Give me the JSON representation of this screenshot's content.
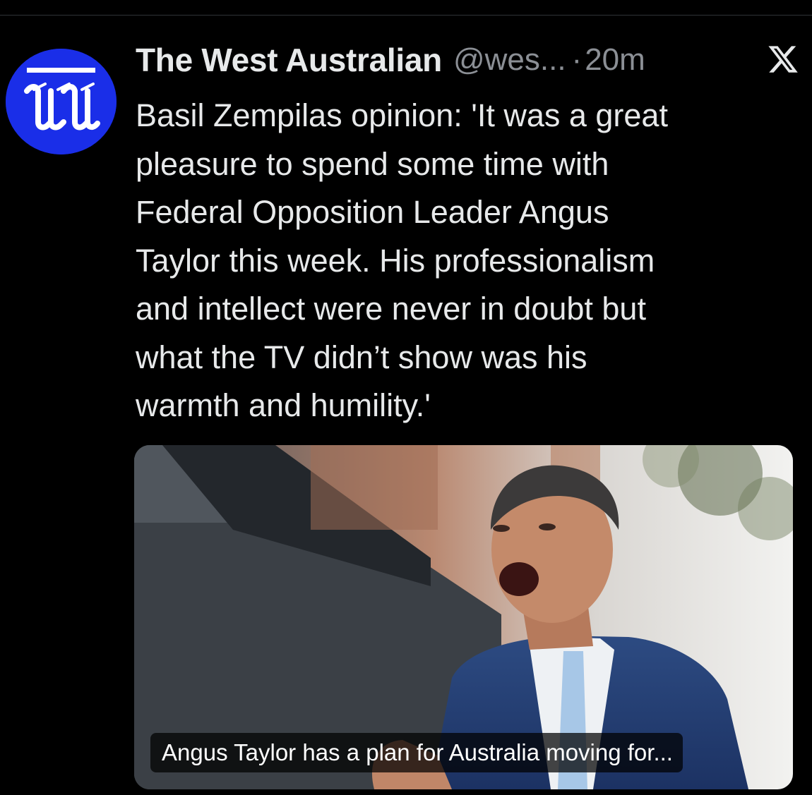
{
  "tweet": {
    "author_name": "The West Australian",
    "handle": "@wes...",
    "separator": "·",
    "timestamp": "20m",
    "text": "Basil Zempilas opinion: 'It was a great\npleasure to spend some time with\nFederal Opposition Leader Angus\nTaylor this week. His professionalism\nand intellect were never in doubt but\nwhat the TV didn’t show was his\nwarmth and humility.'",
    "platform_icon": "x-logo-icon",
    "avatar_logo_text": "W"
  },
  "media": {
    "caption": "Angus Taylor has a plan for Australia moving for..."
  },
  "colors": {
    "background": "#000000",
    "text_primary": "#e7e9ea",
    "text_secondary": "#8b8f95",
    "avatar_blue": "#1a2ee8"
  }
}
